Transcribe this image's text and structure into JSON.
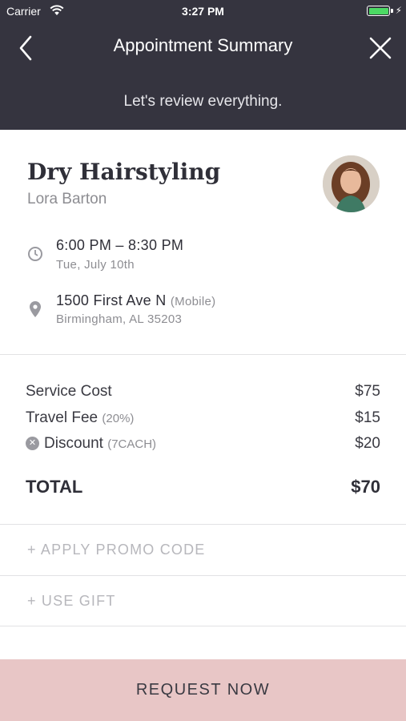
{
  "status_bar": {
    "carrier": "Carrier",
    "time": "3:27 PM",
    "battery_color": "#4cd964"
  },
  "nav": {
    "title": "Appointment Summary",
    "subtitle": "Let's review everything.",
    "back_icon": "chevron-left-icon",
    "close_icon": "close-icon",
    "background": "#35343f"
  },
  "appointment": {
    "service": "Dry Hairstyling",
    "stylist": "Lora Barton",
    "time_range": "6:00 PM – 8:30 PM",
    "date": "Tue, July 10th",
    "address": "1500 First Ave N",
    "address_note": "(Mobile)",
    "city": "Birmingham, AL 35203"
  },
  "costs": {
    "service_label": "Service Cost",
    "service_value": "$75",
    "travel_label": "Travel Fee",
    "travel_note": "(20%)",
    "travel_value": "$15",
    "discount_label": "Discount",
    "discount_note": "(7CACH)",
    "discount_value": "$20",
    "total_label": "TOTAL",
    "total_value": "$70"
  },
  "actions": {
    "promo": "+ APPLY PROMO CODE",
    "gift": "+ USE GIFT"
  },
  "footer": {
    "request_label": "REQUEST NOW",
    "button_color": "#e8c6c6"
  }
}
